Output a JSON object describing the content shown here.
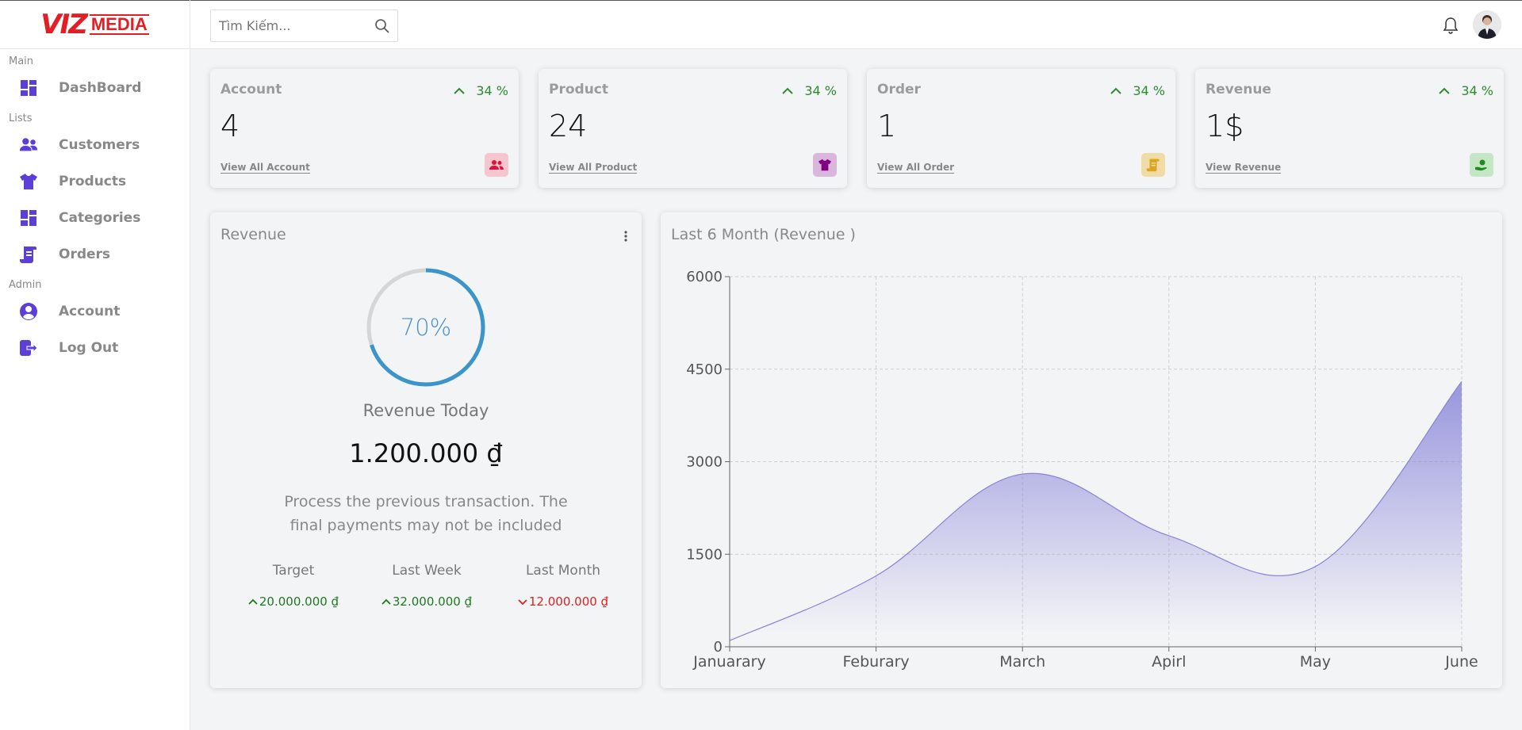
{
  "brand": {
    "logo_main": "VIZ",
    "logo_sub": "MEDIA"
  },
  "search": {
    "placeholder": "Tìm Kiếm..."
  },
  "sidebar": {
    "sections": [
      {
        "title": "Main",
        "items": [
          {
            "label": "DashBoard",
            "icon": "dashboard-icon"
          }
        ]
      },
      {
        "title": "Lists",
        "items": [
          {
            "label": "Customers",
            "icon": "customers-icon"
          },
          {
            "label": "Products",
            "icon": "tshirt-icon"
          },
          {
            "label": "Categories",
            "icon": "categories-icon"
          },
          {
            "label": "Orders",
            "icon": "orders-icon"
          }
        ]
      },
      {
        "title": "Admin",
        "items": [
          {
            "label": "Account",
            "icon": "account-icon"
          },
          {
            "label": "Log Out",
            "icon": "logout-icon"
          }
        ]
      }
    ]
  },
  "widgets": [
    {
      "title": "Account",
      "percent": "34 %",
      "value": "4",
      "link": "View All Account",
      "icon": "users-icon",
      "icon_color": "#dc143c",
      "icon_bg": "#f6c6cf"
    },
    {
      "title": "Product",
      "percent": "34 %",
      "value": "24",
      "link": "View All Product",
      "icon": "tshirt-icon",
      "icon_color": "#800080",
      "icon_bg": "#dab6dd"
    },
    {
      "title": "Order",
      "percent": "34 %",
      "value": "1",
      "link": "View All Order",
      "icon": "receipt-icon",
      "icon_color": "#daa520",
      "icon_bg": "#f1dca6"
    },
    {
      "title": "Revenue",
      "percent": "34 %",
      "value": "1$",
      "link": "View Revenue",
      "icon": "money-icon",
      "icon_color": "#1e8b1e",
      "icon_bg": "#c4e6c4"
    }
  ],
  "featured": {
    "title": "Revenue",
    "progress_label": "70%",
    "progress": 0.7,
    "subtitle": "Revenue Today",
    "amount": "1.200.000 ₫",
    "description": "Process the previous transaction. The final payments may not be included",
    "summary": [
      {
        "label": "Target",
        "value": "20.000.000 ₫",
        "trend": "up"
      },
      {
        "label": "Last Week",
        "value": "32.000.000 ₫",
        "trend": "up"
      },
      {
        "label": "Last Month",
        "value": "12.000.000 ₫",
        "trend": "down"
      }
    ]
  },
  "colors": {
    "accent": "#5b3fd6",
    "positive": "#1f7a1f",
    "negative": "#e02020",
    "area": "#8884d8",
    "ring": "#3d94c8"
  },
  "chart_data": {
    "type": "area",
    "title": "Last 6 Month (Revenue )",
    "categories": [
      "Januarary",
      "Feburary",
      "March",
      "Apirl",
      "May",
      "June"
    ],
    "series": [
      {
        "values": [
          100,
          1150,
          2800,
          1800,
          1300,
          4300
        ]
      }
    ],
    "ylim": [
      0,
      6000
    ],
    "yticks": [
      "0",
      "1500",
      "3000",
      "4500",
      "6000"
    ],
    "grid": true
  }
}
